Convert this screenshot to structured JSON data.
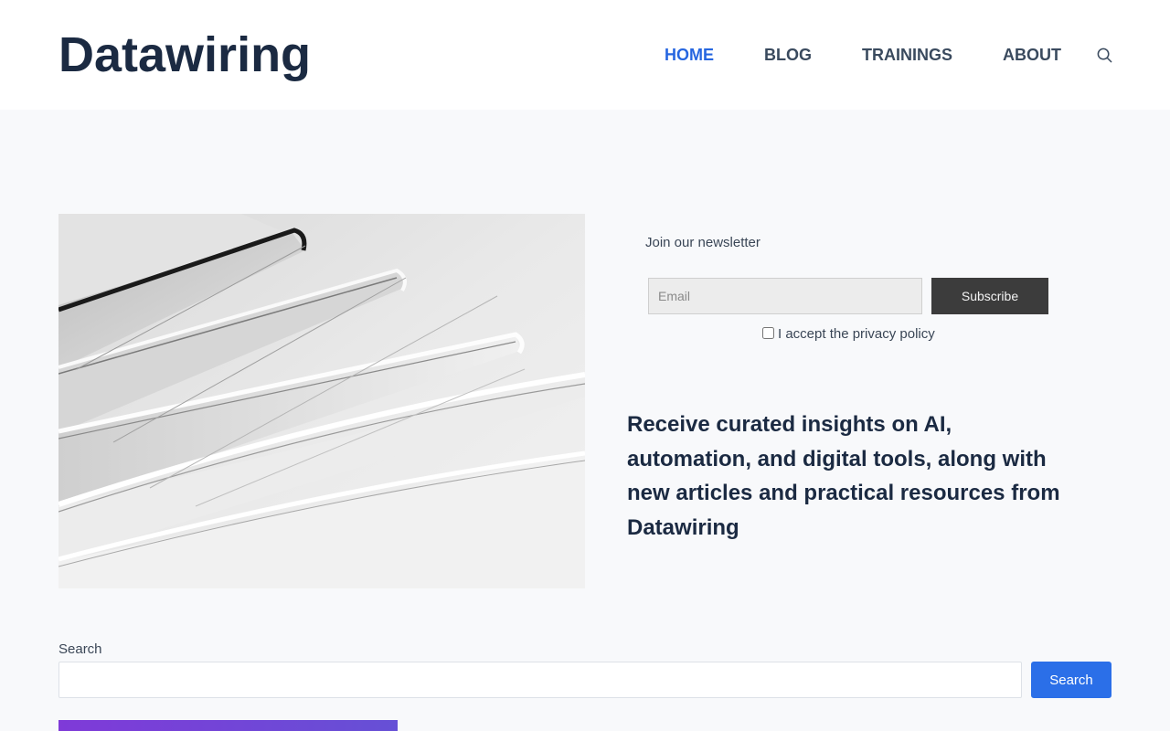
{
  "site": {
    "title": "Datawiring"
  },
  "nav": {
    "items": [
      {
        "label": "HOME",
        "active": true
      },
      {
        "label": "BLOG",
        "active": false
      },
      {
        "label": "TRAININGS",
        "active": false
      },
      {
        "label": "ABOUT",
        "active": false
      }
    ],
    "search_icon": "search-icon"
  },
  "newsletter": {
    "title": "Join our newsletter",
    "email_placeholder": "Email",
    "email_value": "",
    "subscribe_label": "Subscribe",
    "accept_label": "I accept the privacy policy",
    "accept_checked": false
  },
  "blurb": "Receive curated insights on AI, automation, and digital tools, along with new articles and practical resources from Datawiring",
  "search": {
    "label": "Search",
    "value": "",
    "button_label": "Search"
  },
  "colors": {
    "accent": "#2666e0",
    "brand_text": "#1b2a42",
    "subscribe_bg": "#3c3c3c",
    "search_button": "#2b6fe8",
    "banner_gradient_start": "#7f3ad8",
    "banner_gradient_end": "#6650d6"
  }
}
